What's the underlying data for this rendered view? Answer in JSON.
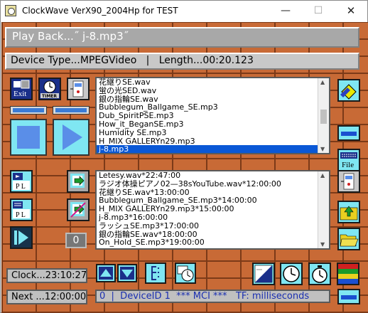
{
  "window": {
    "title": "ClockWave VerX90_2004Hp for TEST",
    "minimize": "—",
    "maximize": "☐",
    "close": "✕"
  },
  "playback": {
    "text": "Play Back...˝ j-8.mp3˝"
  },
  "device": {
    "text": "Device Type...MPEGVideo   |   Length...00:20.123"
  },
  "buttons": {
    "exit_label": "Exit",
    "timer_label": "TIMER",
    "file_label": "File",
    "pl_label": "P L",
    "zero_label": "0"
  },
  "file_list": {
    "items": [
      "花継りSE.wav",
      "蛍の光SED.wav",
      "銀の指輪SE.wav",
      "Bubblegum_Ballgame_SE.mp3",
      "Dub_SpiritPSE.mp3",
      "How_it_BeganSE.mp3",
      "Humidity SE.mp3",
      "H_MIX GALLERYn29.mp3",
      "j-8.mp3"
    ],
    "selected_index": 8
  },
  "playlist": {
    "items": [
      "Letesy.wav*22:47:00",
      "ラジオ体操ピアノ02—38sYouTube.wav*12:00:00",
      "花継りSE.wav*13:00:00",
      "Bubblegum_Ballgame_SE.mp3*14:00:00",
      "H_MIX GALLERYn29.mp3*15:00:00",
      "j-8.mp3*16:00:00",
      "ラッシュSE.mp3*17:00:00",
      "銀の指輪SE.wav*18:00:00",
      "On_Hold_SE.mp3*19:00:00"
    ]
  },
  "status": {
    "clock": "Clock...23:10:27",
    "next": "Next ...12:00:00",
    "mci": "0  |  DeviceID 1  *** MCI ***   TF: milliseconds"
  },
  "colors": {
    "brick": "#c86a36",
    "mortar": "#7c3a18",
    "cyan": "#7fe6f2",
    "blue": "#5a8ee8",
    "navy": "#1a2f8a",
    "selection": "#0a58d6"
  }
}
